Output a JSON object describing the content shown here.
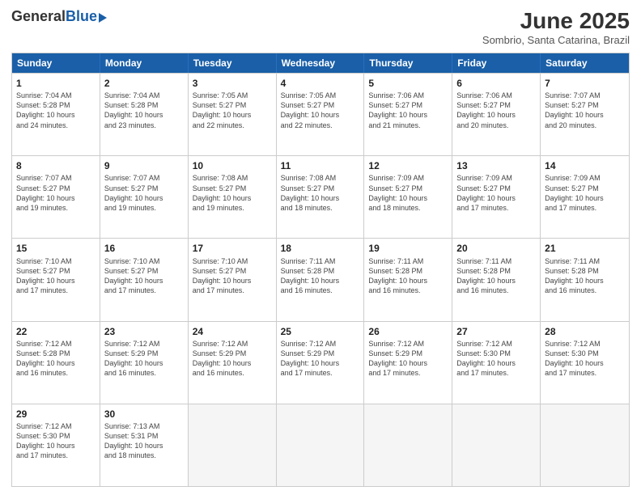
{
  "logo": {
    "general": "General",
    "blue": "Blue"
  },
  "title": "June 2025",
  "subtitle": "Sombrio, Santa Catarina, Brazil",
  "days": [
    "Sunday",
    "Monday",
    "Tuesday",
    "Wednesday",
    "Thursday",
    "Friday",
    "Saturday"
  ],
  "rows": [
    [
      {
        "day": "1",
        "info": "Sunrise: 7:04 AM\nSunset: 5:28 PM\nDaylight: 10 hours\nand 24 minutes."
      },
      {
        "day": "2",
        "info": "Sunrise: 7:04 AM\nSunset: 5:28 PM\nDaylight: 10 hours\nand 23 minutes."
      },
      {
        "day": "3",
        "info": "Sunrise: 7:05 AM\nSunset: 5:27 PM\nDaylight: 10 hours\nand 22 minutes."
      },
      {
        "day": "4",
        "info": "Sunrise: 7:05 AM\nSunset: 5:27 PM\nDaylight: 10 hours\nand 22 minutes."
      },
      {
        "day": "5",
        "info": "Sunrise: 7:06 AM\nSunset: 5:27 PM\nDaylight: 10 hours\nand 21 minutes."
      },
      {
        "day": "6",
        "info": "Sunrise: 7:06 AM\nSunset: 5:27 PM\nDaylight: 10 hours\nand 20 minutes."
      },
      {
        "day": "7",
        "info": "Sunrise: 7:07 AM\nSunset: 5:27 PM\nDaylight: 10 hours\nand 20 minutes."
      }
    ],
    [
      {
        "day": "8",
        "info": "Sunrise: 7:07 AM\nSunset: 5:27 PM\nDaylight: 10 hours\nand 19 minutes."
      },
      {
        "day": "9",
        "info": "Sunrise: 7:07 AM\nSunset: 5:27 PM\nDaylight: 10 hours\nand 19 minutes."
      },
      {
        "day": "10",
        "info": "Sunrise: 7:08 AM\nSunset: 5:27 PM\nDaylight: 10 hours\nand 19 minutes."
      },
      {
        "day": "11",
        "info": "Sunrise: 7:08 AM\nSunset: 5:27 PM\nDaylight: 10 hours\nand 18 minutes."
      },
      {
        "day": "12",
        "info": "Sunrise: 7:09 AM\nSunset: 5:27 PM\nDaylight: 10 hours\nand 18 minutes."
      },
      {
        "day": "13",
        "info": "Sunrise: 7:09 AM\nSunset: 5:27 PM\nDaylight: 10 hours\nand 17 minutes."
      },
      {
        "day": "14",
        "info": "Sunrise: 7:09 AM\nSunset: 5:27 PM\nDaylight: 10 hours\nand 17 minutes."
      }
    ],
    [
      {
        "day": "15",
        "info": "Sunrise: 7:10 AM\nSunset: 5:27 PM\nDaylight: 10 hours\nand 17 minutes."
      },
      {
        "day": "16",
        "info": "Sunrise: 7:10 AM\nSunset: 5:27 PM\nDaylight: 10 hours\nand 17 minutes."
      },
      {
        "day": "17",
        "info": "Sunrise: 7:10 AM\nSunset: 5:27 PM\nDaylight: 10 hours\nand 17 minutes."
      },
      {
        "day": "18",
        "info": "Sunrise: 7:11 AM\nSunset: 5:28 PM\nDaylight: 10 hours\nand 16 minutes."
      },
      {
        "day": "19",
        "info": "Sunrise: 7:11 AM\nSunset: 5:28 PM\nDaylight: 10 hours\nand 16 minutes."
      },
      {
        "day": "20",
        "info": "Sunrise: 7:11 AM\nSunset: 5:28 PM\nDaylight: 10 hours\nand 16 minutes."
      },
      {
        "day": "21",
        "info": "Sunrise: 7:11 AM\nSunset: 5:28 PM\nDaylight: 10 hours\nand 16 minutes."
      }
    ],
    [
      {
        "day": "22",
        "info": "Sunrise: 7:12 AM\nSunset: 5:28 PM\nDaylight: 10 hours\nand 16 minutes."
      },
      {
        "day": "23",
        "info": "Sunrise: 7:12 AM\nSunset: 5:29 PM\nDaylight: 10 hours\nand 16 minutes."
      },
      {
        "day": "24",
        "info": "Sunrise: 7:12 AM\nSunset: 5:29 PM\nDaylight: 10 hours\nand 16 minutes."
      },
      {
        "day": "25",
        "info": "Sunrise: 7:12 AM\nSunset: 5:29 PM\nDaylight: 10 hours\nand 17 minutes."
      },
      {
        "day": "26",
        "info": "Sunrise: 7:12 AM\nSunset: 5:29 PM\nDaylight: 10 hours\nand 17 minutes."
      },
      {
        "day": "27",
        "info": "Sunrise: 7:12 AM\nSunset: 5:30 PM\nDaylight: 10 hours\nand 17 minutes."
      },
      {
        "day": "28",
        "info": "Sunrise: 7:12 AM\nSunset: 5:30 PM\nDaylight: 10 hours\nand 17 minutes."
      }
    ],
    [
      {
        "day": "29",
        "info": "Sunrise: 7:12 AM\nSunset: 5:30 PM\nDaylight: 10 hours\nand 17 minutes."
      },
      {
        "day": "30",
        "info": "Sunrise: 7:13 AM\nSunset: 5:31 PM\nDaylight: 10 hours\nand 18 minutes."
      },
      {
        "day": "",
        "info": ""
      },
      {
        "day": "",
        "info": ""
      },
      {
        "day": "",
        "info": ""
      },
      {
        "day": "",
        "info": ""
      },
      {
        "day": "",
        "info": ""
      }
    ]
  ]
}
